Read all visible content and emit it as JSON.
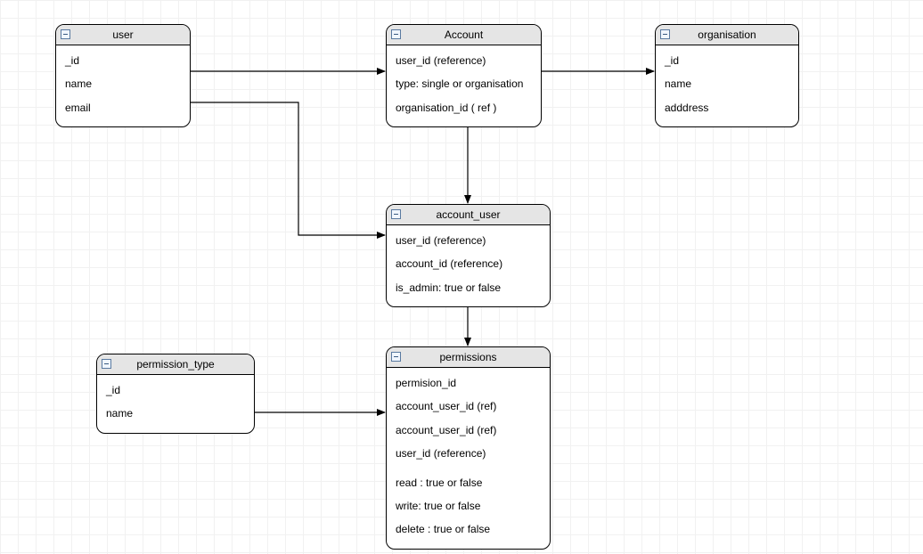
{
  "entities": {
    "user": {
      "title": "user",
      "rows": [
        "_id",
        "name",
        "email"
      ]
    },
    "account": {
      "title": "Account",
      "rows": [
        "user_id (reference)",
        "type:  single or organisation",
        "organisation_id ( ref )"
      ]
    },
    "organisation": {
      "title": "organisation",
      "rows": [
        "_id",
        "name",
        "adddress"
      ]
    },
    "account_user": {
      "title": "account_user",
      "rows": [
        "user_id (reference)",
        "account_id (reference)",
        "is_admin: true or false"
      ]
    },
    "permission_type": {
      "title": "permission_type",
      "rows": [
        "_id",
        "name"
      ]
    },
    "permissions": {
      "title": "permissions",
      "rows": [
        "permision_id",
        "account_user_id (ref)",
        "account_user_id (ref)",
        "user_id (reference)",
        "read : true or false",
        "write: true or false",
        "delete : true or false"
      ]
    }
  },
  "relations": [
    {
      "from": "user",
      "to": "account"
    },
    {
      "from": "account",
      "to": "organisation"
    },
    {
      "from": "account",
      "to": "account_user"
    },
    {
      "from": "user",
      "to": "account_user"
    },
    {
      "from": "account_user",
      "to": "permissions"
    },
    {
      "from": "permission_type",
      "to": "permissions"
    }
  ],
  "collapse_glyph": "minus-icon"
}
